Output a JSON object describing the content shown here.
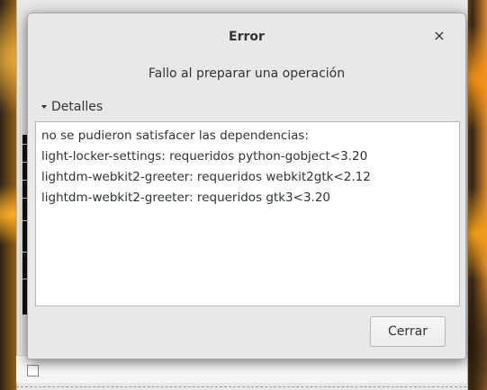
{
  "dialog": {
    "title": "Error",
    "close_icon": "close-icon",
    "message": "Fallo al preparar una operación",
    "expander_label": "Detalles",
    "details": [
      "no se pudieron satisfacer las dependencias:",
      "light-locker-settings: requeridos python-gobject<3.20",
      "lightdm-webkit2-greeter: requeridos webkit2gtk<2.12",
      "lightdm-webkit2-greeter: requeridos gtk3<3.20"
    ],
    "close_button_label": "Cerrar"
  },
  "icons": {
    "close": "×",
    "expander": "chevron-down-icon"
  }
}
